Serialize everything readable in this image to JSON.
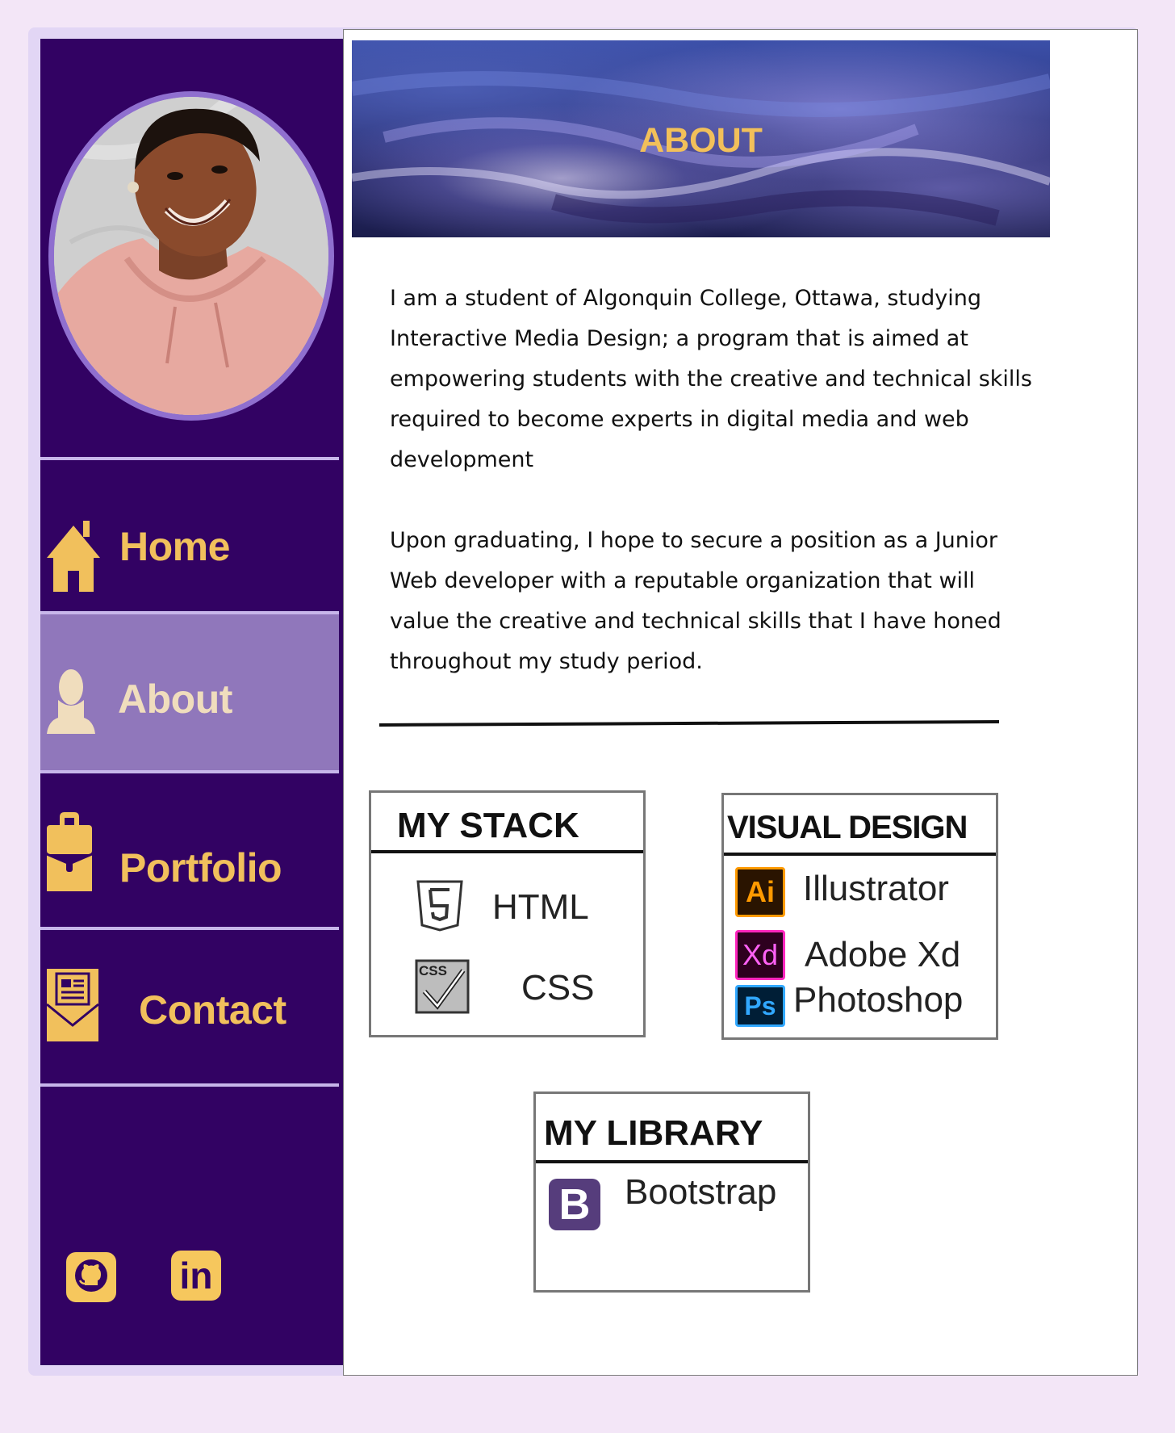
{
  "sidebar": {
    "nav": [
      {
        "label": "Home",
        "icon": "home-icon"
      },
      {
        "label": "About",
        "icon": "person-icon",
        "active": true
      },
      {
        "label": "Portfolio",
        "icon": "briefcase-icon"
      },
      {
        "label": "Contact",
        "icon": "envelope-icon"
      }
    ],
    "social": [
      {
        "icon": "github-icon"
      },
      {
        "icon": "linkedin-icon",
        "glyph": "in"
      }
    ]
  },
  "main": {
    "banner_title": "ABOUT",
    "paragraphs": [
      "I am a student of Algonquin College, Ottawa, studying Interactive Media Design; a program that is aimed at empowering students with the creative and technical skills required to become experts in digital media and web development",
      "Upon graduating, I hope to secure a position as a Junior Web developer with a reputable organization that will value the creative and technical  skills that  I have honed throughout my study period."
    ],
    "stack": {
      "title": "MY STACK",
      "items": [
        {
          "label": "HTML",
          "badge": "5"
        },
        {
          "label": "CSS",
          "badge": "CSS"
        }
      ]
    },
    "visual_design": {
      "title": "VISUAL DESIGN",
      "items": [
        {
          "label": "Illustrator",
          "badge": "Ai"
        },
        {
          "label": "Adobe Xd",
          "badge": "Xd"
        },
        {
          "label": "Photoshop",
          "badge": "Ps"
        }
      ]
    },
    "library": {
      "title": "MY LIBRARY",
      "items": [
        {
          "label": "Bootstrap",
          "badge": "B"
        }
      ]
    }
  },
  "colors": {
    "sidebar_bg": "#320263",
    "accent_gold": "#f1c05c",
    "active_nav": "#9077bb",
    "page_bg": "#f3e6f7"
  }
}
